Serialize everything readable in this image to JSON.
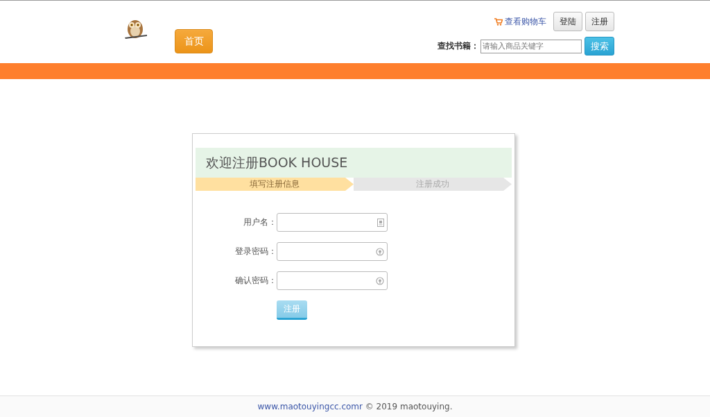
{
  "header": {
    "home_button": "首页",
    "cart_link": "查看购物车",
    "login_button": "登陆",
    "register_button": "注册",
    "search": {
      "label": "查找书籍：",
      "placeholder": "请输入商品关键字",
      "button": "搜索"
    }
  },
  "register_card": {
    "title": "欢迎注册BOOK HOUSE",
    "steps": [
      {
        "label": "填写注册信息",
        "selected": true
      },
      {
        "label": "注册成功",
        "selected": false
      }
    ],
    "fields": [
      {
        "label": "用户名：",
        "kind": "user"
      },
      {
        "label": "登录密码：",
        "kind": "password"
      },
      {
        "label": "确认密码：",
        "kind": "password"
      }
    ],
    "submit_button": "注册"
  },
  "footer": {
    "link": "www.maotouyingcc.comr",
    "text": "© 2019 maotouying."
  }
}
